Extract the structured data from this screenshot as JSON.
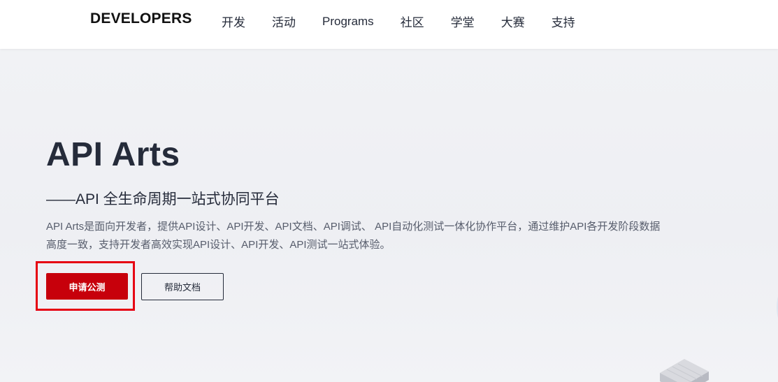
{
  "header": {
    "brand": "DEVELOPERS",
    "nav": [
      {
        "label": "开发"
      },
      {
        "label": "活动"
      },
      {
        "label": "Programs"
      },
      {
        "label": "社区"
      },
      {
        "label": "学堂"
      },
      {
        "label": "大赛"
      },
      {
        "label": "支持"
      }
    ]
  },
  "hero": {
    "title": "API Arts",
    "subtitle": "——API 全生命周期一站式协同平台",
    "description": "API Arts是面向开发者，提供API设计、API开发、API文档、API调试、 API自动化测试一体化协作平台，通过维护API各开发阶段数据高度一致，支持开发者高效实现API设计、API开发、API测试一站式体验。",
    "primary_button": "申请公测",
    "secondary_button": "帮助文档"
  },
  "colors": {
    "accent": "#c7000b",
    "highlight": "#e60012",
    "text_dark": "#252b3a",
    "text_muted": "#575d6c"
  }
}
